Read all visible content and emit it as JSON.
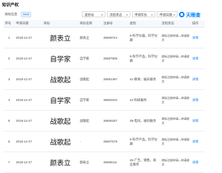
{
  "section_title": "知识产权",
  "toolbar": {
    "trademark_label": "商标信息",
    "trademark_count": "5868",
    "filters": [
      "类别号",
      "流程状态",
      "申请年份",
      "申请日期"
    ],
    "logo_text": "天眼查"
  },
  "table": {
    "headers": [
      "序号",
      "申请日期",
      "商标",
      "商标名称",
      "注册号",
      "类别",
      "流程状态",
      "操作"
    ],
    "rows": [
      {
        "idx": "1",
        "date": "2018-12-27",
        "mark": "颜表立",
        "name": "颜表立",
        "reg": "35609744",
        "category": "9-科学仪器，科学仪器",
        "status": "商标注册申请—申请收文",
        "op": "详情"
      },
      {
        "idx": "2",
        "date": "2018-12-27",
        "mark": "自学家",
        "name": "自学家",
        "reg": "35597905",
        "category": "9-科学产品，科学仪器",
        "status": "商标注册申请—申请收文",
        "op": "详情"
      },
      {
        "idx": "3",
        "date": "2018-12-27",
        "mark": "战歌起",
        "name": "战歌起",
        "reg": "35591497",
        "category": "41-教育、娱乐服务",
        "status": "商标注册申请—申请收文",
        "op": "详情"
      },
      {
        "idx": "4",
        "date": "2018-12-27",
        "mark": "自学家",
        "name": "自学家",
        "reg": "35604910",
        "category": "42-科研服务",
        "status": "商标注册申请—申请收文",
        "op": "详情"
      },
      {
        "idx": "5",
        "date": "2018-12-27",
        "mark": "战歌起",
        "name": "战歌起",
        "reg": "35606257",
        "category": "38-电讯、通讯服务",
        "status": "商标注册申请—申请收文",
        "op": "详情"
      },
      {
        "idx": "6",
        "date": "2018-12-27",
        "mark": "战歌起",
        "name": "-",
        "reg": "35607579",
        "category": "9-科学产品，科学仪器",
        "status": "商标注册申请—申请收文",
        "op": "详情"
      },
      {
        "idx": "7",
        "date": "2018-12-27",
        "mark": "颜表立",
        "name": "颜表立",
        "reg": "35599411",
        "category": "35-广告、销售、商业服务",
        "status": "商标注册申请—申请收文",
        "op": "详情"
      }
    ]
  }
}
